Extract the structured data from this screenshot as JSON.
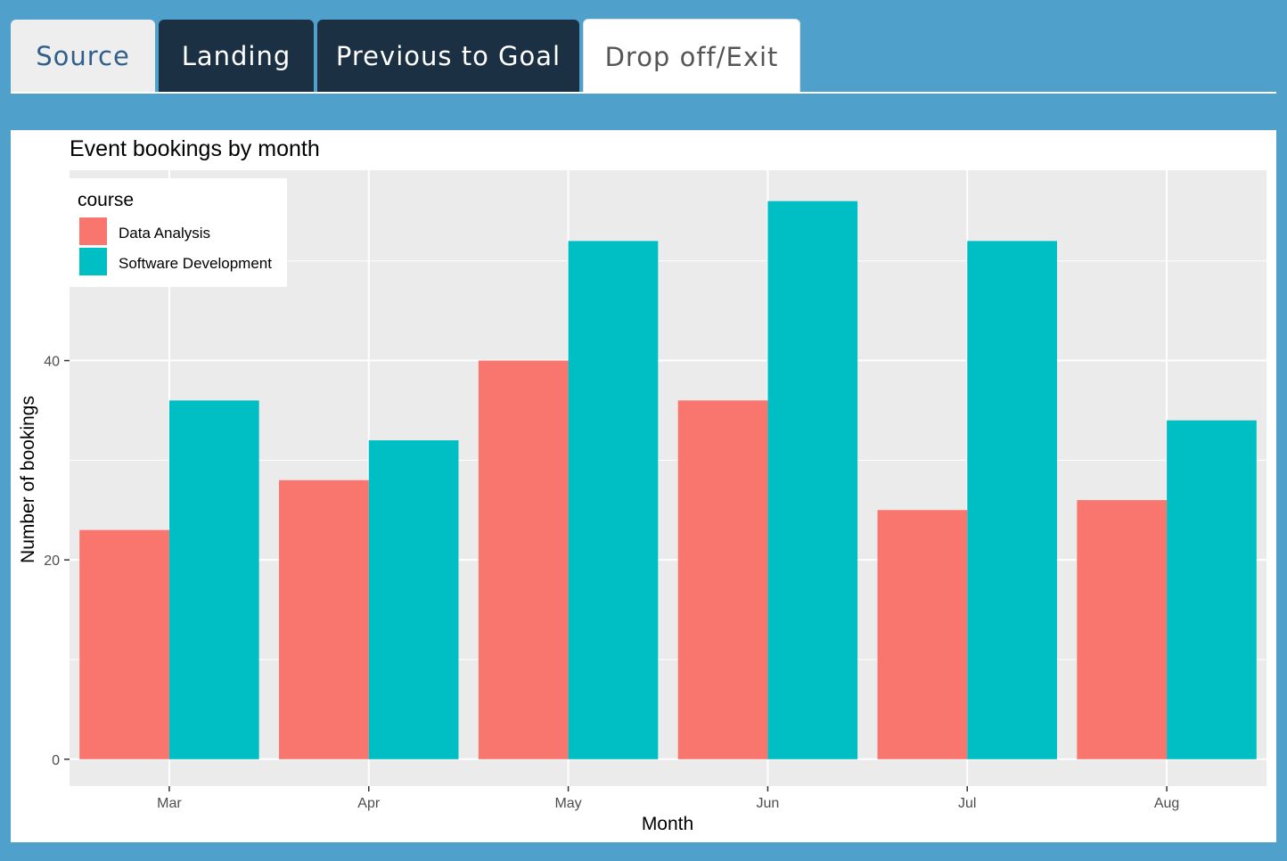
{
  "tabs": [
    {
      "label": "Source",
      "style": "light"
    },
    {
      "label": "Landing",
      "style": "dark"
    },
    {
      "label": "Previous to Goal",
      "style": "dark"
    },
    {
      "label": "Drop off/Exit",
      "style": "active"
    }
  ],
  "colors": {
    "page_background": "#4fa1cc",
    "tab_dark": "#1c3044",
    "panel_grey": "#ebebeb",
    "data_analysis": "#f8766d",
    "software_development": "#00bfc4"
  },
  "chart_data": {
    "type": "bar",
    "title": "Event bookings by month",
    "xlabel": "Month",
    "ylabel": "Number of bookings",
    "categories": [
      "Mar",
      "Apr",
      "May",
      "Jun",
      "Jul",
      "Aug"
    ],
    "series": [
      {
        "name": "Data Analysis",
        "color": "#f8766d",
        "values": [
          23,
          28,
          40,
          36,
          25,
          26
        ]
      },
      {
        "name": "Software Development",
        "color": "#00bfc4",
        "values": [
          36,
          32,
          52,
          56,
          52,
          34
        ]
      }
    ],
    "legend_title": "course",
    "legend_position": "top-left",
    "yticks": [
      0,
      20,
      40
    ],
    "ylim": [
      -2.7,
      59.1
    ],
    "grid": true
  }
}
